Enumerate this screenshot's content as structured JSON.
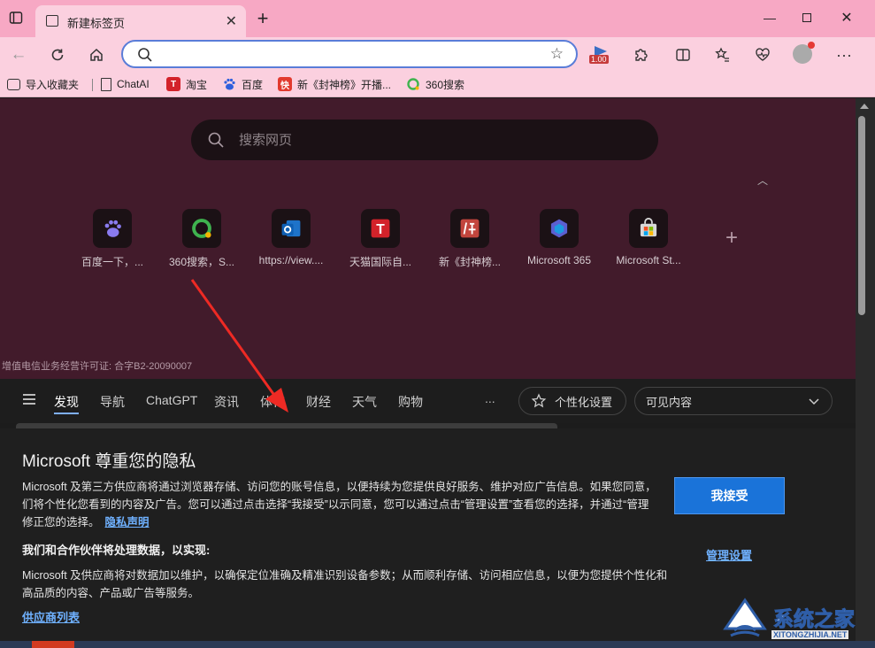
{
  "window": {
    "tab_title": "新建标签页",
    "new_tab_glyph": "+",
    "close_glyph": "✕",
    "minimize_glyph": "—"
  },
  "toolbar": {
    "address_value": "",
    "address_placeholder": "",
    "badge_value": "1.00"
  },
  "bookmarks": {
    "items": [
      {
        "label": "导入收藏夹",
        "icon": "import-icon"
      },
      {
        "label": "ChatAI",
        "icon": "page-icon"
      },
      {
        "label": "淘宝",
        "icon": "taobao-icon",
        "glyph": "T",
        "color": "#d3222a"
      },
      {
        "label": "百度",
        "icon": "baidu-icon"
      },
      {
        "label": "新《封神榜》开播...",
        "icon": "fengshen-icon",
        "glyph": "快",
        "color": "#e23a2e"
      },
      {
        "label": "360搜索",
        "icon": "360-icon"
      }
    ]
  },
  "ntp": {
    "search_placeholder": "搜索网页",
    "tiles": [
      {
        "label": "百度一下，...",
        "icon": "baidu-icon"
      },
      {
        "label": "360搜索，S...",
        "icon": "360-icon"
      },
      {
        "label": "https://view....",
        "icon": "outlook-icon"
      },
      {
        "label": "天猫国际自...",
        "icon": "tmall-icon"
      },
      {
        "label": "新《封神榜...",
        "icon": "fengshen-icon"
      },
      {
        "label": "Microsoft 365",
        "icon": "m365-icon"
      },
      {
        "label": "Microsoft St...",
        "icon": "msstore-icon"
      }
    ],
    "add_glyph": "+",
    "license_text": "增值电信业务经营许可证: 合字B2-20090007"
  },
  "feednav": {
    "items": [
      "发现",
      "导航",
      "ChatGPT",
      "资讯",
      "体育",
      "财经",
      "天气",
      "购物"
    ],
    "more": "...",
    "personalize_label": "个性化设置",
    "visible_label": "可见内容"
  },
  "privacy": {
    "title": "Microsoft 尊重您的隐私",
    "body_line1": "Microsoft 及第三方供应商将通过浏览器存储、访问您的账号信息，以便持续为您提供良好服务、维护对应广告信息。如果您同意，",
    "body_line2": "们将个性化您看到的内容及广告。您可以通过点击选择“我接受”以示同意，您可以通过点击“管理设置”查看您的选择，并通过“管理",
    "body_line3": "修正您的选择。",
    "privacy_link": "隐私声明",
    "subheading": "我们和合作伙伴将处理数据，以实现:",
    "body2_line1": "Microsoft 及供应商将对数据加以维护，以确保定位准确及精准识别设备参数；从而顺利存储、访问相应信息，以便为您提供个性化和",
    "body2_line2": "高品质的内容、产品或广告等服务。",
    "vendor_link": "供应商列表",
    "accept_button": "我接受",
    "manage_link": "管理设置"
  },
  "watermark": {
    "text": "系统之家",
    "sub": "XITONGZHIJIA.NET"
  },
  "colors": {
    "titlebar": "#f7a8c4",
    "toolbar": "#fbd0df",
    "ntp_bg": "#421b2b",
    "accent": "#1a73d9",
    "link": "#6fb1ff",
    "arrow": "#ee2a24"
  }
}
